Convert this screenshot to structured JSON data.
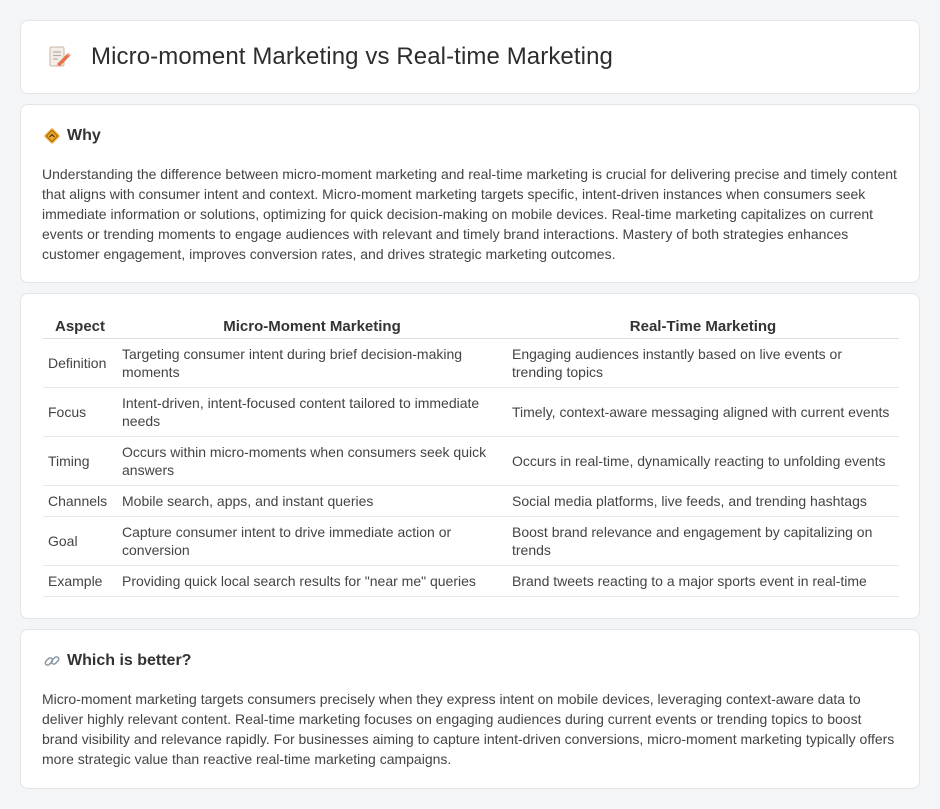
{
  "header": {
    "title": "Micro-moment Marketing vs Real-time Marketing",
    "icon": "document-pencil-icon"
  },
  "why": {
    "heading": "Why",
    "icon": "diamond-sign-icon",
    "text": "Understanding the difference between micro-moment marketing and real-time marketing is crucial for delivering precise and timely content that aligns with consumer intent and context. Micro-moment marketing targets specific, intent-driven instances when consumers seek immediate information or solutions, optimizing for quick decision-making on mobile devices. Real-time marketing capitalizes on current events or trending moments to engage audiences with relevant and timely brand interactions. Mastery of both strategies enhances customer engagement, improves conversion rates, and drives strategic marketing outcomes."
  },
  "table": {
    "headers": [
      "Aspect",
      "Micro-Moment Marketing",
      "Real-Time Marketing"
    ],
    "rows": [
      [
        "Definition",
        "Targeting consumer intent during brief decision-making moments",
        "Engaging audiences instantly based on live events or trending topics"
      ],
      [
        "Focus",
        "Intent-driven, intent-focused content tailored to immediate needs",
        "Timely, context-aware messaging aligned with current events"
      ],
      [
        "Timing",
        "Occurs within micro-moments when consumers seek quick answers",
        "Occurs in real-time, dynamically reacting to unfolding events"
      ],
      [
        "Channels",
        "Mobile search, apps, and instant queries",
        "Social media platforms, live feeds, and trending hashtags"
      ],
      [
        "Goal",
        "Capture consumer intent to drive immediate action or conversion",
        "Boost brand relevance and engagement by capitalizing on trends"
      ],
      [
        "Example",
        "Providing quick local search results for \"near me\" queries",
        "Brand tweets reacting to a major sports event in real-time"
      ]
    ]
  },
  "better": {
    "heading": "Which is better?",
    "icon": "link-icon",
    "text": "Micro-moment marketing targets consumers precisely when they express intent on mobile devices, leveraging context-aware data to deliver highly relevant content. Real-time marketing focuses on engaging audiences during current events or trending topics to boost brand visibility and relevance rapidly. For businesses aiming to capture intent-driven conversions, micro-moment marketing typically offers more strategic value than reactive real-time marketing campaigns."
  }
}
